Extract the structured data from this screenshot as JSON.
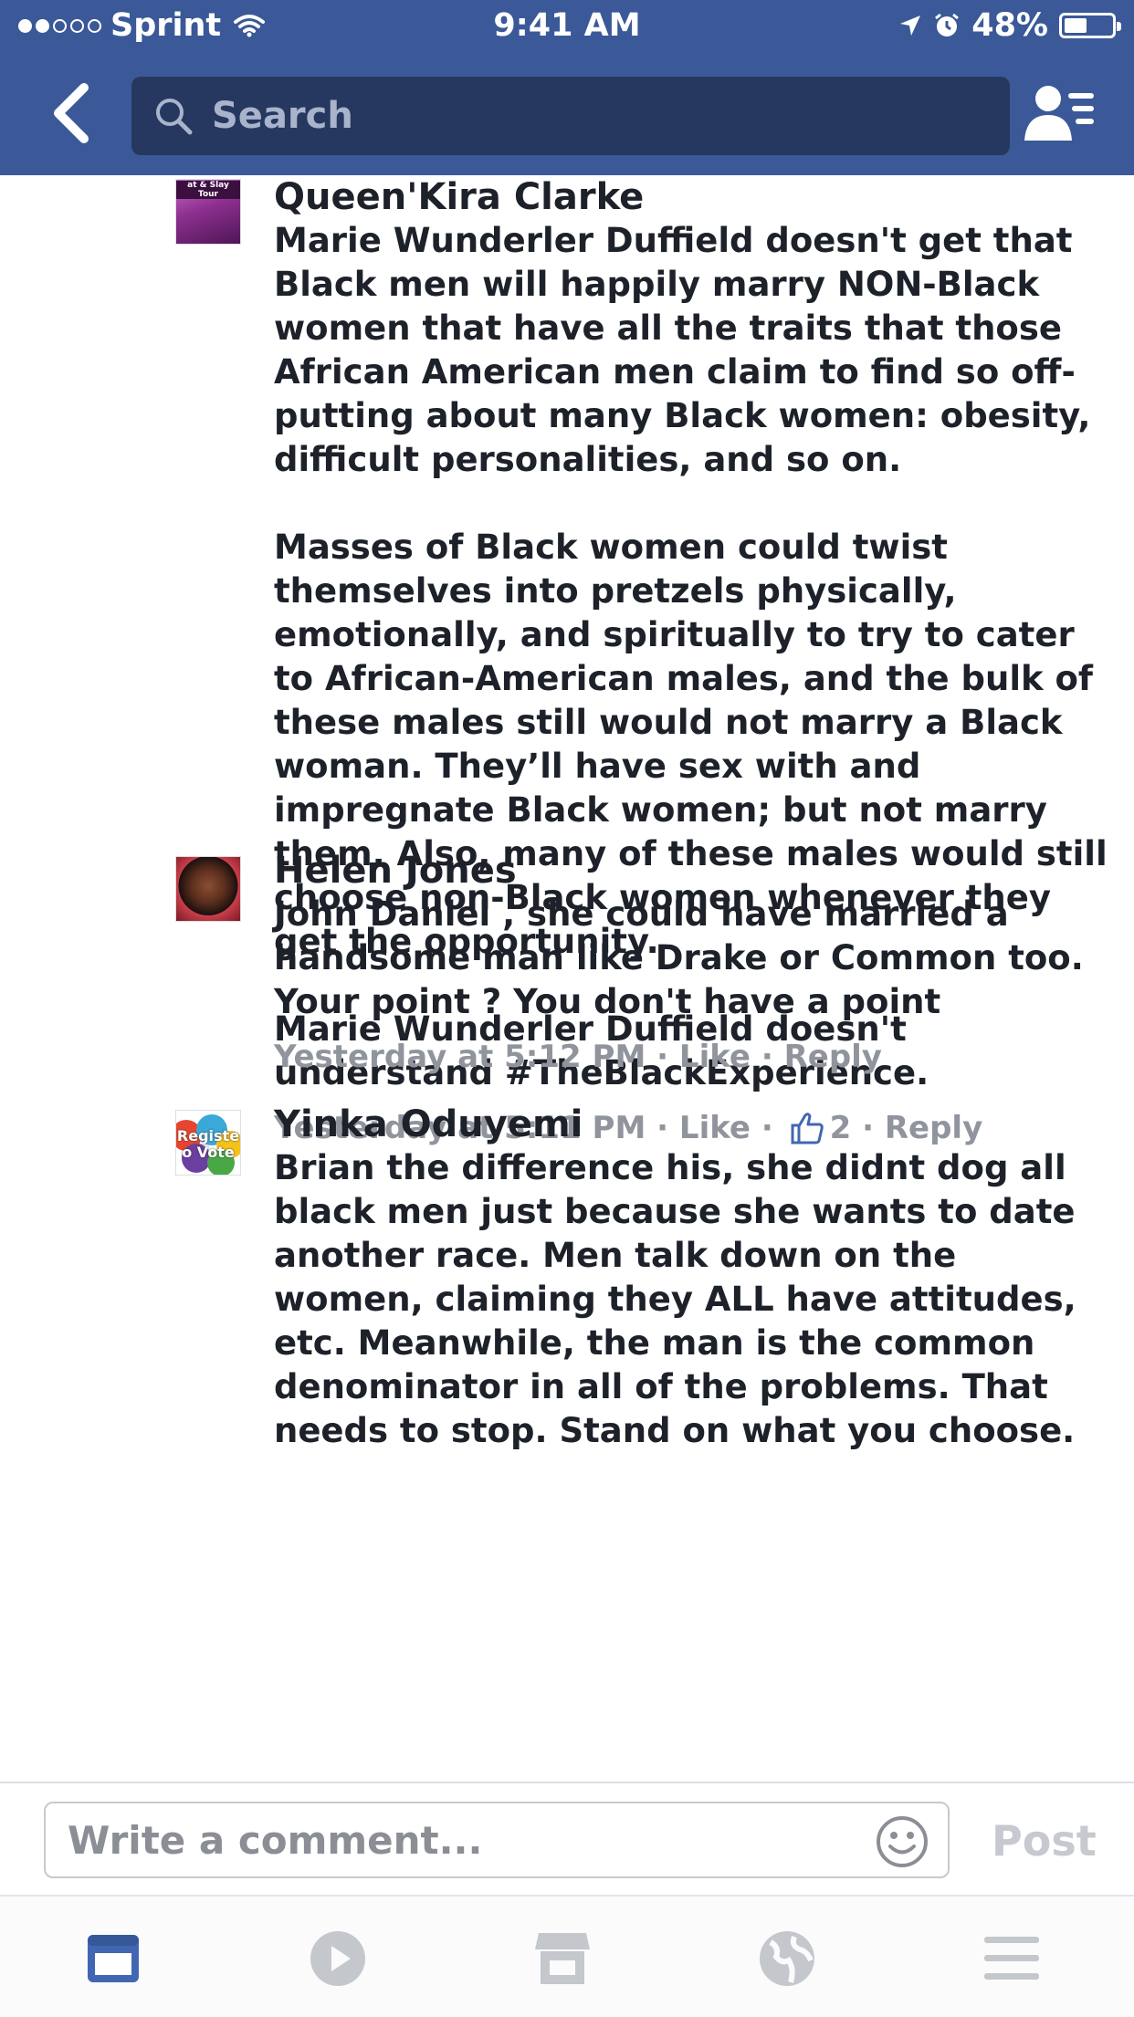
{
  "status_bar": {
    "carrier": "Sprint",
    "time": "9:41 AM",
    "battery": "48%",
    "battery_level": 0.48,
    "signal_bars_filled": 2,
    "signal_bars_total": 5
  },
  "nav": {
    "back_icon": "chevron-left-icon",
    "search_placeholder": "Search",
    "friends_icon": "friend-requests-icon"
  },
  "comments": [
    {
      "author": "Queen'Kira Clarke",
      "avatar_text": "at & Slay Tour",
      "text_1": "Marie Wunderler Duffield doesn't get that Black men will happily marry NON-Black women that have all the traits that those African American men claim to find so off-putting about many Black women: obesity, difficult personalities, and so on.",
      "text_2": "Masses of Black women could twist themselves into pretzels physically, emotionally, and spiritually to try to cater to African-American males, and the bulk of these males still would not marry a Black woman. They’ll have sex with and impregnate Black women; but not marry them. Also, many of these males would still choose non-Black women whenever they get the opportunity.",
      "text_3_prefix": "Marie Wunderler Duffield doesn't understand ",
      "text_3_hashtag": "#TheBlackExperience",
      "text_3_suffix": ".",
      "time": "Yesterday at 5:11 PM",
      "like_label": "Like",
      "like_count": "2",
      "reply_label": "Reply"
    },
    {
      "author": "Helen Jones",
      "text": "John Daniel , she could have married a handsome man like Drake or Common too. Your point ? You don't have a point",
      "time": "Yesterday at 5:12 PM",
      "like_label": "Like",
      "reply_label": "Reply"
    },
    {
      "author": "Yinka Oduyemi",
      "avatar_text_1": "Registe",
      "avatar_text_2": "o Vote",
      "text": "Brian the difference his, she didnt dog all black men just because she wants to date another race. Men talk down on the women, claiming they ALL have attitudes, etc. Meanwhile, the man is the common denominator in all of the problems. That needs to stop. Stand on what you choose."
    }
  ],
  "composer": {
    "placeholder": "Write a comment...",
    "post_label": "Post",
    "emoji_icon": "smiley-icon"
  },
  "tabbar": {
    "tabs": [
      "news-feed-icon",
      "video-icon",
      "marketplace-icon",
      "notifications-globe-icon",
      "menu-icon"
    ],
    "active_tab": "news-feed-icon",
    "active_color": "#4267b2",
    "inactive_color": "#c4c7cc"
  },
  "colors": {
    "header_blue": "#3b5998",
    "search_bg": "#26385f",
    "meta_gray": "#90949c"
  }
}
